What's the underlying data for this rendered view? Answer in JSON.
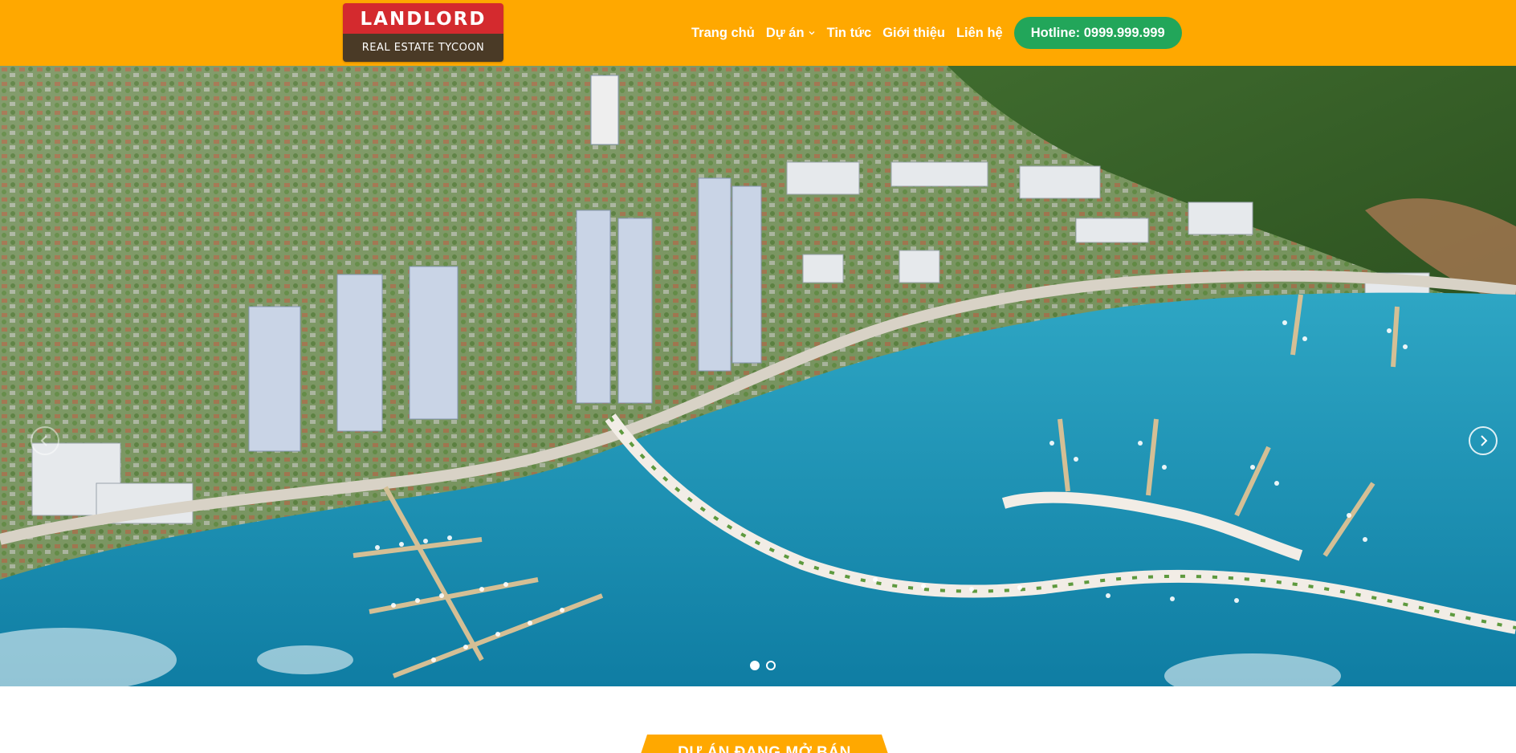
{
  "logo": {
    "brand": "LANDLORD",
    "tagline": "REAL ESTATE TYCOON"
  },
  "nav": {
    "items": [
      {
        "label": "Trang chủ"
      },
      {
        "label": "Dự án",
        "has_dropdown": true
      },
      {
        "label": "Tin tức"
      },
      {
        "label": "Giới thiệu"
      },
      {
        "label": "Liên hệ"
      }
    ],
    "hotline": "Hotline: 0999.999.999"
  },
  "slider": {
    "slide_count": 2,
    "active_index": 0
  },
  "section": {
    "title": "DỰ ÁN ĐANG MỞ BÁN"
  },
  "colors": {
    "header": "#ffa800",
    "logo_red": "#d42a2e",
    "logo_brown": "#4a3a26",
    "hotline_green": "#22a65a",
    "sea": "#1d8fb3"
  },
  "icons": {
    "dropdown": "chevron-down-icon",
    "prev": "chevron-left-icon",
    "next": "chevron-right-icon"
  }
}
